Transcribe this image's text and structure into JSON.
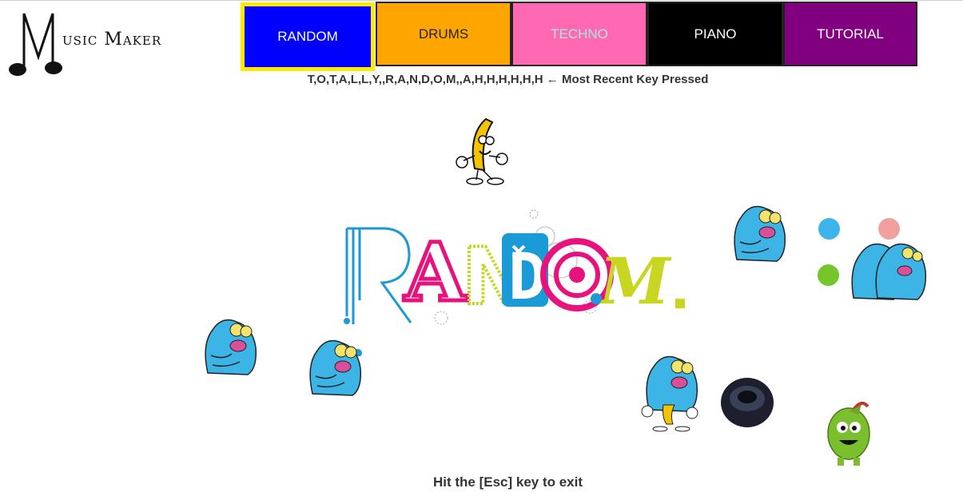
{
  "app": {
    "logo_initial": "M",
    "logo_text": "usic Maker"
  },
  "nav": {
    "buttons": [
      {
        "label": "RANDOM",
        "bg": "#0000ff",
        "fg": "#ffffff",
        "active": true
      },
      {
        "label": "DRUMS",
        "bg": "#ffa500",
        "fg": "#222222",
        "active": false
      },
      {
        "label": "TECHNO",
        "bg": "#ff69b4",
        "fg": "#a6e7e0",
        "active": false
      },
      {
        "label": "PIANO",
        "bg": "#000000",
        "fg": "#ffffff",
        "active": false
      },
      {
        "label": "TUTORIAL",
        "bg": "#800080",
        "fg": "#ffffff",
        "active": false
      }
    ]
  },
  "status": {
    "recent_keys": "T,O,T,A,L,L,Y,,R,A,N,D,O,M,,A,H,H,H,H,H,H",
    "recent_suffix": "← Most Recent Key Pressed"
  },
  "main": {
    "banner_letters": [
      "R",
      "A",
      "N",
      "D",
      "O",
      "M"
    ],
    "exit_hint": "Hit the [Esc] key to exit"
  },
  "colors": {
    "banner_blue": "#1a9ad6",
    "banner_pink": "#e6137e",
    "banner_lime": "#c9d621",
    "monster_blue": "#3cb4e6",
    "dot_blue": "#3cb4ec",
    "dot_pink": "#f2a09f",
    "dot_green": "#74c62b"
  }
}
